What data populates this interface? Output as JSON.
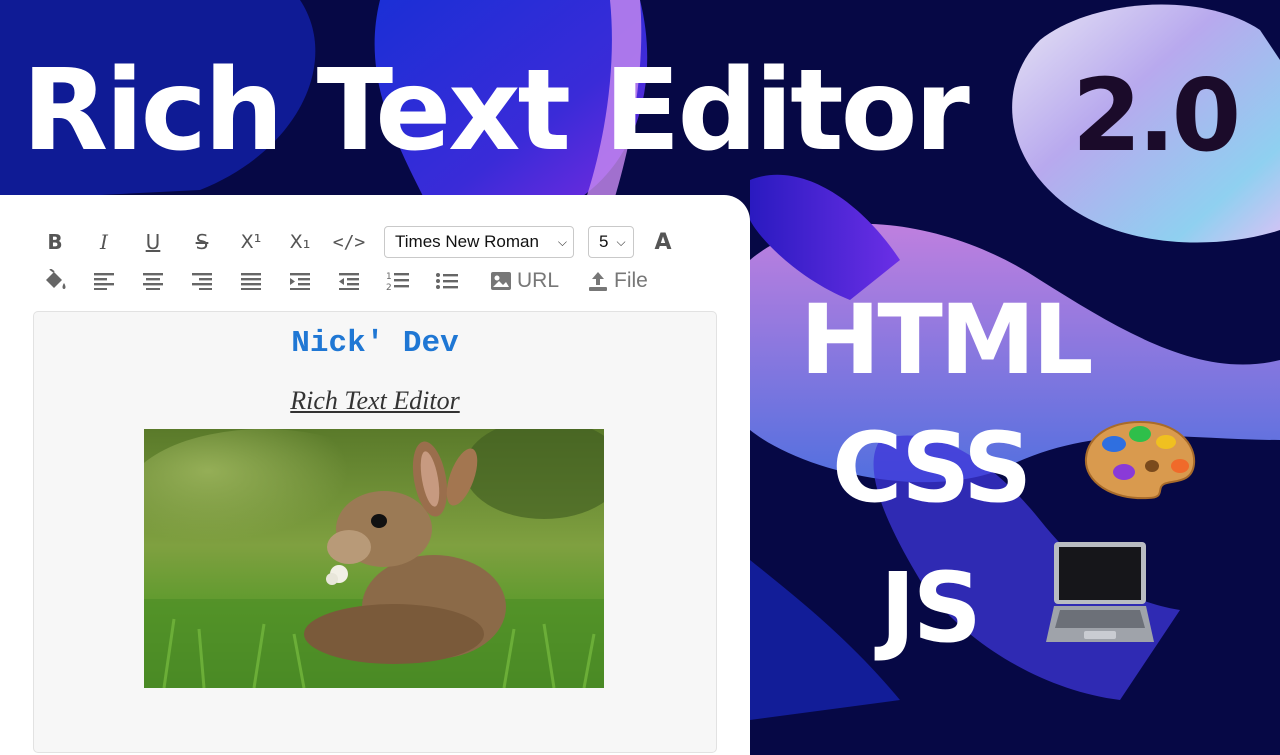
{
  "page": {
    "title": "Rich Text Editor",
    "version": "2.0",
    "tech_stack": [
      "HTML",
      "CSS",
      "JS"
    ],
    "palette_icon": "artist-palette-icon",
    "laptop_icon": "laptop-icon"
  },
  "editor": {
    "toolbar_row1": [
      {
        "name": "bold-icon",
        "glyph": "B"
      },
      {
        "name": "italic-icon",
        "glyph": "I"
      },
      {
        "name": "underline-icon",
        "glyph": "U"
      },
      {
        "name": "strikethrough-icon",
        "glyph": "S"
      },
      {
        "name": "superscript-icon",
        "glyph": "X¹"
      },
      {
        "name": "subscript-icon",
        "glyph": "X₁"
      },
      {
        "name": "code-icon",
        "glyph": "</>"
      }
    ],
    "font_select": "Times New Roman",
    "size_select": "5",
    "font_color_icon": "font-color-icon",
    "toolbar_row2": [
      "fill-color-icon",
      "align-left-icon",
      "align-center-icon",
      "align-right-icon",
      "align-justify-icon",
      "indent-icon",
      "outdent-icon",
      "ordered-list-icon",
      "unordered-list-icon"
    ],
    "image_url_label": "URL",
    "file_label": "File",
    "content": {
      "heading": "Nick' Dev",
      "subheading": "Rich Text Editor",
      "image": "rabbit-photo"
    }
  },
  "colors": {
    "background": "#060845",
    "heading_blue": "#1f77d4",
    "toolbar_icon": "#555555"
  }
}
